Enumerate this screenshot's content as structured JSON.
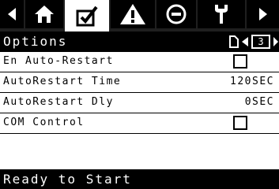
{
  "tabs": [
    {
      "icon": "left-arrow-icon"
    },
    {
      "icon": "home-icon"
    },
    {
      "icon": "checklist-icon",
      "active": true
    },
    {
      "icon": "warning-icon"
    },
    {
      "icon": "stop-icon"
    },
    {
      "icon": "wrench-icon"
    },
    {
      "icon": "right-arrow-icon"
    }
  ],
  "header": {
    "title": "Options",
    "page_number": "3"
  },
  "rows": [
    {
      "label": "En Auto-Restart",
      "type": "checkbox",
      "checked": false
    },
    {
      "label": "AutoRestart Time",
      "type": "value",
      "value": "120SEC"
    },
    {
      "label": "AutoRestart Dly",
      "type": "value",
      "value": "0SEC"
    },
    {
      "label": "COM Control",
      "type": "checkbox",
      "checked": false
    }
  ],
  "status": {
    "text": "Ready to Start"
  }
}
